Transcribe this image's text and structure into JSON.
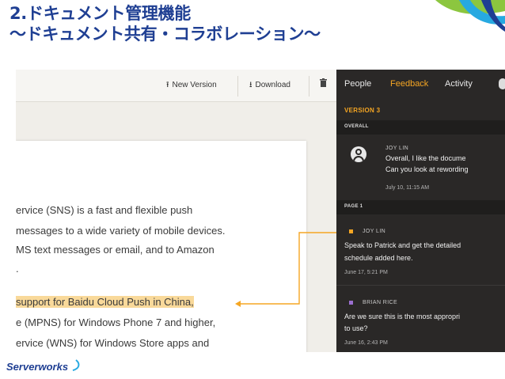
{
  "slide": {
    "title_line1": "2.ドキュメント管理機能",
    "title_line2": "～ドキュメント共有・コラボレーション～",
    "logo_prefix": "Server",
    "logo_suffix": "works"
  },
  "toolbar": {
    "new_version_label": "New Version",
    "download_label": "Download"
  },
  "document": {
    "lines": [
      "ervice (SNS) is a fast and flexible push",
      "messages to a wide variety of mobile devices.",
      "MS text messages or email, and to Amazon",
      ".",
      "support for Baidu Cloud Push in China,",
      "e (MPNS) for Windows Phone 7 and higher,",
      "ervice (WNS) for Windows Store apps and"
    ]
  },
  "panel": {
    "tabs": [
      "People",
      "Feedback",
      "Activity"
    ],
    "active_tab": "Feedback",
    "version_label": "VERSION 3",
    "overall_label": "OVERALL",
    "page1_label": "PAGE 1",
    "comments": [
      {
        "author": "JOY LIN",
        "line1": "Overall, I like the docume",
        "line2": "Can you look at rewording",
        "date": "July 10, 11:15 AM"
      },
      {
        "author": "JOY LIN",
        "line1": "Speak to Patrick and get the detailed",
        "line2": "schedule added here.",
        "date": "June 17, 5:21 PM"
      },
      {
        "author": "BRIAN RICE",
        "line1": "Are we sure this is the most appropri",
        "line2": "to use?",
        "date": "June 16, 2:43 PM"
      }
    ]
  },
  "colors": {
    "title": "#1f3f93",
    "accent_orange": "#f5a623",
    "highlight": "#f9d99a",
    "panel_bg": "#2a2827",
    "marker_purple": "#9b6fd0"
  }
}
